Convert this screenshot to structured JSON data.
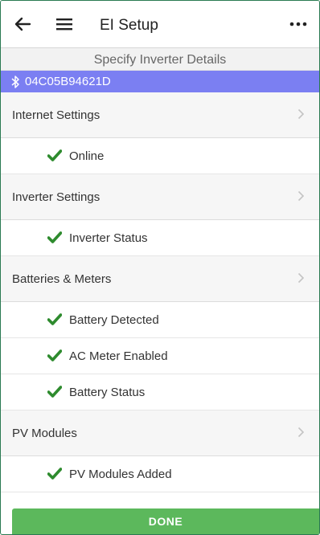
{
  "header": {
    "title": "EI Setup",
    "back_icon": "arrow-left-icon",
    "menu_icon": "hamburger-menu-icon",
    "more_icon": "more-dots-icon"
  },
  "subtitle": "Specify Inverter Details",
  "device": {
    "id": "04C05B94621D",
    "icon": "bluetooth-icon"
  },
  "sections": [
    {
      "label": "Internet Settings",
      "items": [
        "Online"
      ]
    },
    {
      "label": "Inverter Settings",
      "items": [
        "Inverter Status"
      ]
    },
    {
      "label": "Batteries & Meters",
      "items": [
        "Battery Detected",
        "AC Meter Enabled",
        "Battery Status"
      ]
    },
    {
      "label": "PV Modules",
      "items": [
        "PV Modules Added"
      ]
    }
  ],
  "done_label": "DONE",
  "colors": {
    "accent": "#7b7ff2",
    "check": "#2e8b2e",
    "done": "#5cb85c"
  }
}
